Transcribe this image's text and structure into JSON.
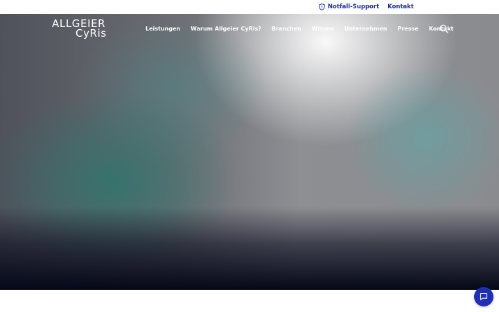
{
  "topbar": {
    "emergency_label": "Notfall-Support",
    "contact_label": "Kontakt"
  },
  "logo": {
    "line1": "ALLGEIER",
    "line2": "CyRis"
  },
  "nav": {
    "items": [
      "Leistungen",
      "Warum Allgeier CyRis?",
      "Branchen",
      "Wissen",
      "Unternehmen",
      "Presse",
      "Kontakt"
    ]
  },
  "icons": {
    "emergency": "shield-icon",
    "search": "search-icon",
    "chat": "chat-bubble-icon"
  },
  "colors": {
    "brand_blue": "#1f2fb5",
    "link_blue": "#1a2fa8"
  }
}
